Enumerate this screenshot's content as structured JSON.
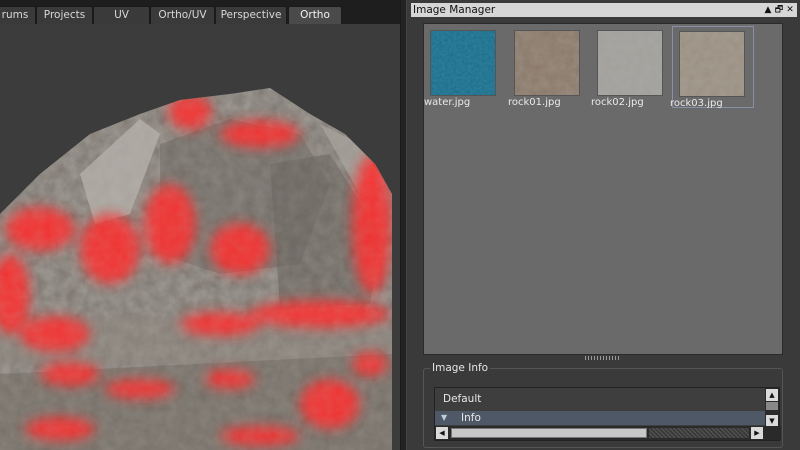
{
  "viewport": {
    "tabs": [
      {
        "label": "rums",
        "active": false
      },
      {
        "label": "Projects",
        "active": false
      },
      {
        "label": "UV",
        "active": false
      },
      {
        "label": "Ortho/UV",
        "active": false
      },
      {
        "label": "Perspective",
        "active": false
      },
      {
        "label": "Ortho",
        "active": true
      }
    ],
    "terrain_colors": {
      "rock": "#7a746d",
      "highlight": "#ff2a2a",
      "background": "#3c3c3c"
    }
  },
  "image_manager": {
    "title": "Image Manager",
    "window_buttons": {
      "pin": "▲",
      "restore": "🗗",
      "close": "✕"
    },
    "images": [
      {
        "label": "water.jpg",
        "icon": "water-texture",
        "color": "#1d6a86"
      },
      {
        "label": "rock01.jpg",
        "icon": "rock-texture",
        "color": "#8a7868"
      },
      {
        "label": "rock02.jpg",
        "icon": "rock-texture",
        "color": "#a3a09b"
      },
      {
        "label": "rock03.jpg",
        "icon": "rock-texture",
        "color": "#9a8e80"
      }
    ],
    "selected_index": 3
  },
  "image_info": {
    "title": "Image Info",
    "tree": {
      "default_label": "Default",
      "info_label": "Info",
      "info_expand_icon": "▼"
    },
    "scroll_up_icon": "▲",
    "scroll_down_icon": "▼",
    "scroll_left_icon": "◀",
    "scroll_right_icon": "▶"
  }
}
